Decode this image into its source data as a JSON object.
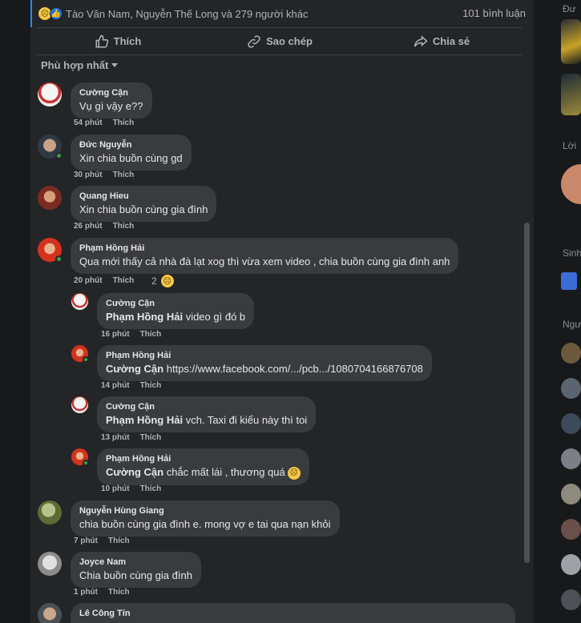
{
  "reactions": {
    "names": "Tào Văn Nam, Nguyễn Thế Long và 279 người khác",
    "comment_count": "101 bình luận"
  },
  "actions": {
    "like": "Thích",
    "copy": "Sao chép",
    "share": "Chia sẻ"
  },
  "sort": {
    "label": "Phù hợp nhất"
  },
  "comments": [
    {
      "name": "Cường Cận",
      "text": "Vụ gì vậy e??",
      "time": "54 phút",
      "like": "Thích"
    },
    {
      "name": "Đức Nguyễn",
      "text": "Xin chia buồn cùng gd",
      "time": "30 phút",
      "like": "Thích"
    },
    {
      "name": "Quang Hieu",
      "text": "Xin chia buồn cùng gia đình",
      "time": "26 phút",
      "like": "Thích"
    },
    {
      "name": "Phạm Hồng Hải",
      "text": "Qua mới thấy cả nhà đà lạt xog thì vừa xem video , chia buồn cùng gia đình anh",
      "time": "20 phút",
      "like": "Thích",
      "reaction_count": "2"
    },
    {
      "name": "Nguyễn Hùng Giang",
      "text": "chia buồn cùng gia đình e. mong vợ e tai qua nạn khỏi",
      "time": "7 phút",
      "like": "Thích"
    },
    {
      "name": "Joyce Nam",
      "text": "Chia buồn cùng gia đình",
      "time": "1 phút",
      "like": "Thích"
    },
    {
      "name": "Lê Công Tín"
    }
  ],
  "replies": [
    {
      "name": "Cường Cận",
      "mention": "Phạm Hồng Hải",
      "text": " video gì đó b",
      "time": "16 phút",
      "like": "Thích"
    },
    {
      "name": "Phạm Hồng Hải",
      "mention": "Cường Cận",
      "text": " https://www.facebook.com/.../pcb.../1080704166876708",
      "time": "14 phút",
      "like": "Thích"
    },
    {
      "name": "Cường Cận",
      "mention": "Phạm Hồng Hải",
      "text": " vch. Taxi đi kiểu này thì toi",
      "time": "13 phút",
      "like": "Thích"
    },
    {
      "name": "Phạm Hồng Hải",
      "mention": "Cường Cận",
      "text": " chắc mất lái , thương quá",
      "time": "10 phút",
      "like": "Thích"
    }
  ],
  "sidebar": {
    "labels": [
      "Đư",
      "Lời",
      "Sinh",
      "Ngư"
    ]
  },
  "icons": [
    "sad-react-icon",
    "like-react-icon",
    "like-icon",
    "link-icon",
    "share-icon",
    "caret-down-icon"
  ],
  "colors": {
    "post_bg": "#242526",
    "bubble": "#3a3b3c",
    "online": "#31a24c",
    "accent": "#2d88ff"
  }
}
